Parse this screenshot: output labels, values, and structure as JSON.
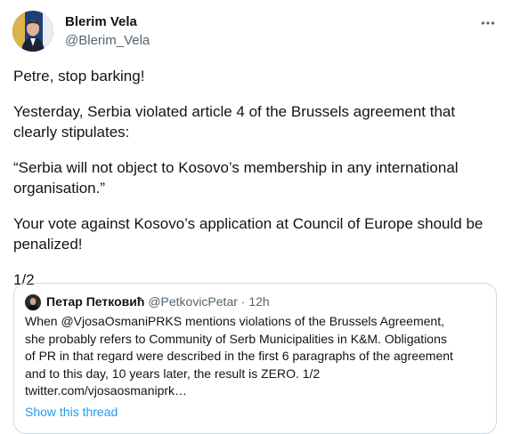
{
  "author": {
    "name": "Blerim Vela",
    "handle": "@Blerim_Vela"
  },
  "more_icon": "more-horizontal-icon",
  "tweet": {
    "paragraphs": [
      "Petre, stop barking!",
      "Yesterday, Serbia violated article 4 of the Brussels agreement that clearly stipulates:",
      "“Serbia will not object to Kosovo’s membership in any international organisation.”",
      "Your vote against Kosovo’s application at Council of Europe should be penalized!",
      "1/2"
    ]
  },
  "quoted": {
    "name": "Петар Петковић",
    "handle": "@PetkovicPetar",
    "separator": "·",
    "time": "12h",
    "lines": [
      "When @VjosaOsmaniPRKS mentions violations of the Brussels Agreement,",
      "she probably refers to Community of Serb Municipalities in K&M. Obligations",
      "of PR in that regard were described in the first 6 paragraphs of the agreement",
      "and to this day, 10 years later, the result is ZERO. 1/2",
      "twitter.com/vjosaosmaniprk…"
    ],
    "show_thread": "Show this thread"
  },
  "colors": {
    "text": "#0f1419",
    "secondary": "#536471",
    "link": "#1d9bf0",
    "border": "#cfd9de"
  }
}
